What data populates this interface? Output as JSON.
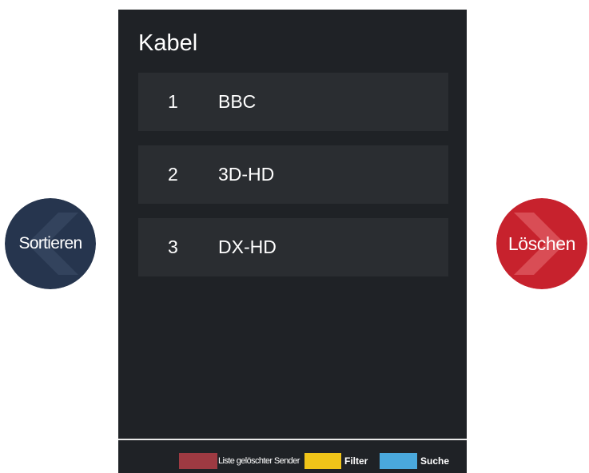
{
  "panel": {
    "title": "Kabel"
  },
  "channels": [
    {
      "number": "1",
      "name": "BBC"
    },
    {
      "number": "2",
      "name": "3D-HD"
    },
    {
      "number": "3",
      "name": "DX-HD"
    }
  ],
  "nav": {
    "left_label": "Sortieren",
    "left_icon": "chevron-left-icon",
    "left_color": "#26354e",
    "right_label": "Löschen",
    "right_icon": "chevron-right-icon",
    "right_color": "#c7222d"
  },
  "legend": [
    {
      "label": "Liste gelöschter Sender",
      "color": "#9e3a42"
    },
    {
      "label": "Filter",
      "color": "#f0c419"
    },
    {
      "label": "Suche",
      "color": "#4aa8dc"
    }
  ]
}
